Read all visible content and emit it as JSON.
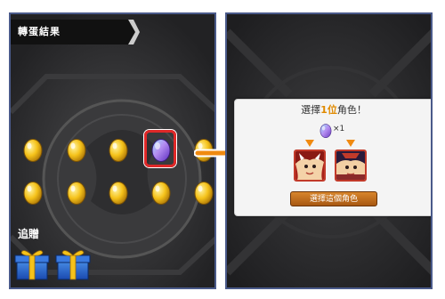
{
  "left_panel": {
    "title": "轉蛋結果",
    "bonus_label": "追贈",
    "eggs": [
      {
        "kind": "gold-egg",
        "selected": false
      },
      {
        "kind": "gold-egg",
        "selected": false
      },
      {
        "kind": "gold-egg",
        "selected": false
      },
      {
        "kind": "rainbow-egg",
        "selected": true
      },
      {
        "kind": "gold-egg",
        "selected": false
      },
      {
        "kind": "gold-egg",
        "selected": false
      },
      {
        "kind": "gold-egg",
        "selected": false
      },
      {
        "kind": "gold-egg",
        "selected": false
      },
      {
        "kind": "gold-egg",
        "selected": false
      },
      {
        "kind": "gold-egg",
        "selected": false
      }
    ],
    "gifts": [
      "gift-box-icon",
      "gift-box-icon"
    ]
  },
  "result_box": {
    "header_prefix": "選擇",
    "header_highlight": "1位",
    "header_suffix": "角色！",
    "egg_count": "×1",
    "characters": [
      "character-portrait-1",
      "character-portrait-2"
    ],
    "select_button": "選擇這個角色"
  },
  "colors": {
    "panel_border": "#4a5a8a",
    "selection_ring": "#e02828",
    "arrow": "#f08a10",
    "button": "#c0701e"
  }
}
